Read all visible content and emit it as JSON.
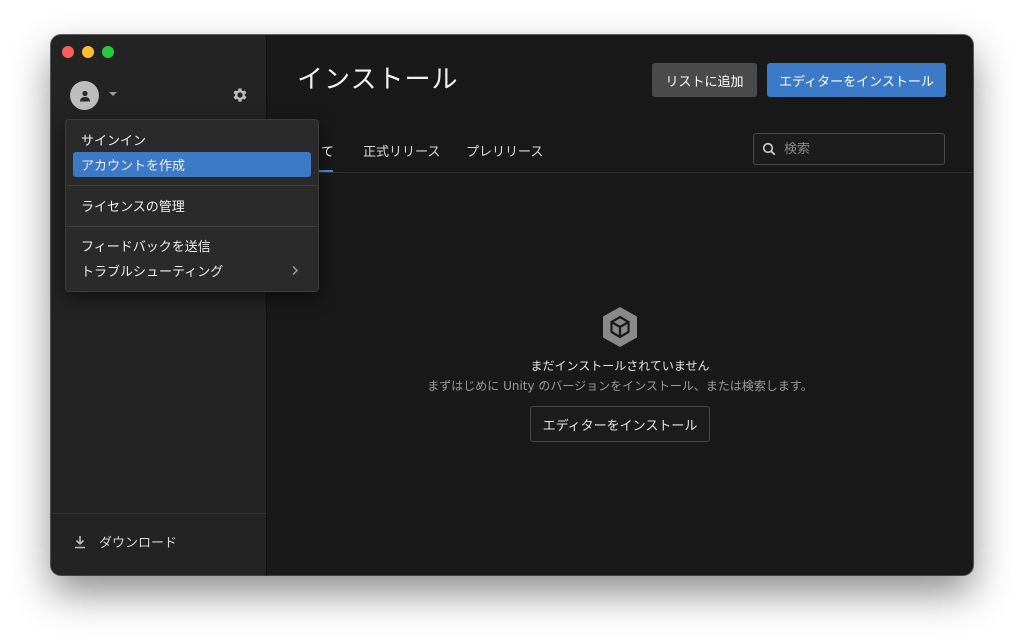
{
  "window": {
    "traffic_lights": [
      "close",
      "minimize",
      "zoom"
    ]
  },
  "sidebar": {
    "avatar_icon": "user-icon",
    "caret_icon": "chevron-down-icon",
    "settings_icon": "gear-icon",
    "download_icon": "download-icon",
    "download_label": "ダウンロード"
  },
  "main": {
    "title": "インストール",
    "buttons": {
      "add_to_list": "リストに追加",
      "install_editor": "エディターをインストール"
    },
    "tabs": [
      {
        "label": "すべて",
        "visible_text": "て",
        "active": true
      },
      {
        "label": "正式リリース",
        "active": false
      },
      {
        "label": "プレリリース",
        "active": false
      }
    ],
    "search": {
      "placeholder": "検索",
      "value": ""
    },
    "empty_state": {
      "icon": "unity-cube-icon",
      "title": "まだインストールされていません",
      "subtitle": "まずはじめに Unity のバージョンをインストール、または検索します。",
      "button": "エディターをインストール"
    }
  },
  "account_menu": {
    "items": [
      {
        "label": "サインイン",
        "selected": false
      },
      {
        "label": "アカウントを作成",
        "selected": true
      },
      {
        "label": "ライセンスの管理",
        "selected": false
      },
      {
        "label": "フィードバックを送信",
        "selected": false
      },
      {
        "label": "トラブルシューティング",
        "selected": false,
        "has_submenu": true
      }
    ]
  },
  "colors": {
    "accent": "#3c79c6",
    "background": "#191919",
    "sidebar": "#232323",
    "menu": "#2a2a2a"
  }
}
